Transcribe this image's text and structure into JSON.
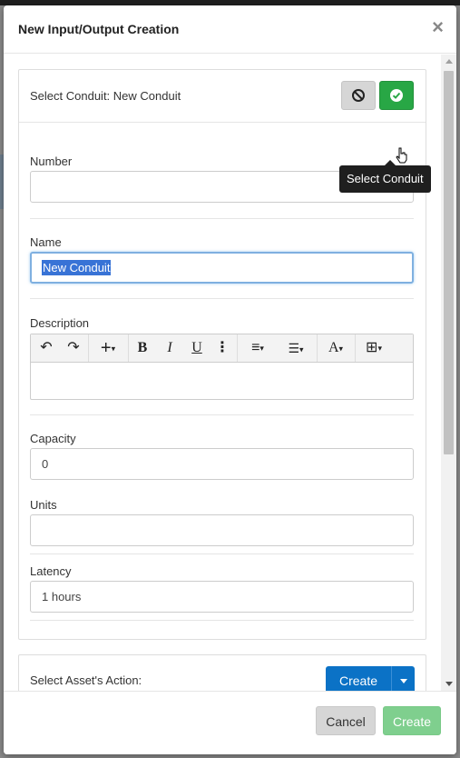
{
  "modal": {
    "title": "New Input/Output Creation",
    "close_glyph": "×"
  },
  "conduit_panel": {
    "label": "Select Conduit: New Conduit",
    "cancel_icon": "ban-icon",
    "select_icon": "check-circle-icon",
    "tooltip": "Select Conduit"
  },
  "fields": {
    "number": {
      "label": "Number",
      "value": ""
    },
    "name": {
      "label": "Name",
      "value": "New Conduit"
    },
    "description": {
      "label": "Description",
      "value": ""
    },
    "capacity": {
      "label": "Capacity",
      "value": "0"
    },
    "units": {
      "label": "Units",
      "value": ""
    },
    "latency": {
      "label": "Latency",
      "value": "1 hours"
    }
  },
  "editor_toolbar": {
    "undo": "↶",
    "redo": "↷",
    "insert": "+",
    "bold": "B",
    "italic": "I",
    "underline": "U",
    "more": "⋮",
    "align": "≡",
    "list": "☰",
    "font": "A",
    "table": "⊞"
  },
  "asset_panel": {
    "label": "Select Asset's Action:",
    "create_label": "Create"
  },
  "footer": {
    "cancel_label": "Cancel",
    "create_label": "Create"
  },
  "colors": {
    "primary": "#0b72c6",
    "success": "#28a745",
    "success_disabled": "#7fcf8e",
    "selection": "#3873d6"
  }
}
